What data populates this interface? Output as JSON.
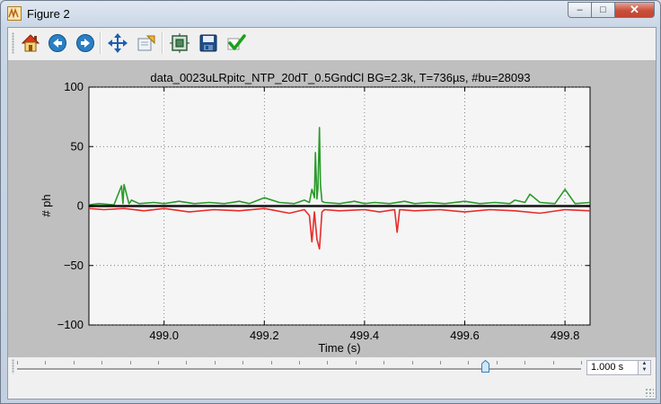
{
  "window": {
    "title": "Figure 2"
  },
  "toolbar": {
    "buttons": [
      "home-icon",
      "back-icon",
      "forward-icon",
      "pan-icon",
      "zoom-icon",
      "subplots-icon",
      "save-icon",
      "apply-icon"
    ]
  },
  "chart_data": {
    "type": "line",
    "title": "data_0023uLRpitc_NTP_20dT_0.5GndCl BG=2.3k, T=736µs, #bu=28093",
    "xlabel": "Time (s)",
    "ylabel": "# ph",
    "xlim": [
      498.85,
      499.85
    ],
    "ylim": [
      -100,
      100
    ],
    "xticks": [
      499.0,
      499.2,
      499.4,
      499.6,
      499.8
    ],
    "xtick_labels": [
      "499.0",
      "499.2",
      "499.4",
      "499.6",
      "499.8"
    ],
    "yticks": [
      100,
      50,
      0,
      -50,
      -100
    ],
    "ytick_labels": [
      "100",
      "50",
      "0",
      "−50",
      "−100"
    ],
    "grid": true,
    "series": [
      {
        "color": "#2a9a2a",
        "x": [
          498.85,
          498.87,
          498.9,
          498.915,
          498.918,
          498.92,
          498.93,
          498.932,
          498.935,
          498.95,
          498.98,
          499.0,
          499.03,
          499.06,
          499.09,
          499.12,
          499.15,
          499.17,
          499.2,
          499.23,
          499.26,
          499.28,
          499.29,
          499.295,
          499.3,
          499.302,
          499.305,
          499.307,
          499.31,
          499.312,
          499.315,
          499.32,
          499.35,
          499.38,
          499.4,
          499.42,
          499.45,
          499.48,
          499.5,
          499.53,
          499.56,
          499.6,
          499.63,
          499.66,
          499.69,
          499.7,
          499.72,
          499.73,
          499.75,
          499.78,
          499.8,
          499.82,
          499.85
        ],
        "y": [
          1,
          2,
          1,
          17,
          2,
          18,
          2,
          3,
          5,
          2,
          3,
          2,
          4,
          2,
          3,
          2,
          4,
          2,
          7,
          3,
          2,
          5,
          3,
          14,
          7,
          45,
          6,
          15,
          66,
          18,
          4,
          3,
          2,
          4,
          2,
          3,
          2,
          4,
          2,
          3,
          2,
          4,
          2,
          3,
          2,
          5,
          3,
          10,
          3,
          2,
          14,
          2,
          3
        ]
      },
      {
        "color": "#e82b2b",
        "x": [
          498.85,
          498.88,
          498.92,
          498.96,
          499.0,
          499.05,
          499.1,
          499.15,
          499.2,
          499.25,
          499.28,
          499.29,
          499.295,
          499.3,
          499.305,
          499.31,
          499.315,
          499.32,
          499.35,
          499.4,
          499.43,
          499.46,
          499.465,
          499.47,
          499.5,
          499.55,
          499.6,
          499.65,
          499.7,
          499.75,
          499.8,
          499.85
        ],
        "y": [
          -2,
          -3,
          -2,
          -4,
          -2,
          -5,
          -3,
          -4,
          -2,
          -6,
          -3,
          -8,
          -30,
          -5,
          -28,
          -36,
          -5,
          -3,
          -4,
          -3,
          -5,
          -3,
          -22,
          -3,
          -4,
          -3,
          -5,
          -3,
          -4,
          -6,
          -3,
          -4
        ]
      },
      {
        "color": "#111111",
        "x": [
          498.85,
          499.85
        ],
        "y": [
          0,
          0
        ]
      }
    ]
  },
  "bottom": {
    "value": "1.000 s",
    "slider_fraction": 0.83
  }
}
